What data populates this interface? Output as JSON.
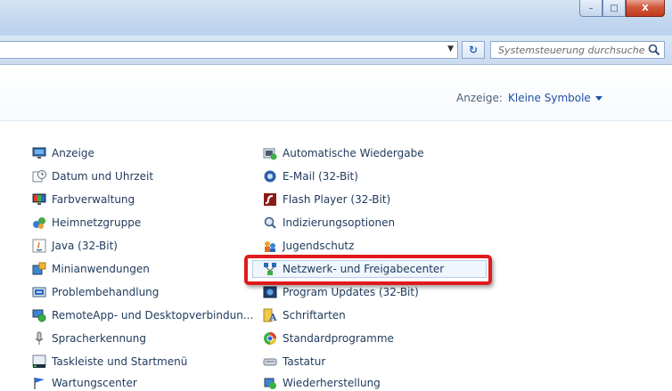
{
  "window": {
    "minimize_label": "–",
    "maximize_label": "□",
    "close_label": "X"
  },
  "toolbar": {
    "refresh_label": "↻",
    "search": {
      "placeholder": "Systemsteuerung durchsuchen",
      "value": ""
    }
  },
  "view": {
    "label": "Anzeige:",
    "selected": "Kleine Symbole"
  },
  "left_column": [
    {
      "label": "Anzeige",
      "icon": "display-icon"
    },
    {
      "label": "Datum und Uhrzeit",
      "icon": "clock-icon"
    },
    {
      "label": "Farbverwaltung",
      "icon": "color-management-icon"
    },
    {
      "label": "Heimnetzgruppe",
      "icon": "homegroup-icon"
    },
    {
      "label": "Java (32-Bit)",
      "icon": "java-icon"
    },
    {
      "label": "Minianwendungen",
      "icon": "gadgets-icon"
    },
    {
      "label": "Problembehandlung",
      "icon": "troubleshooting-icon"
    },
    {
      "label": "RemoteApp- und Desktopverbindun...",
      "icon": "remoteapp-icon"
    },
    {
      "label": "Spracherkennung",
      "icon": "microphone-icon"
    },
    {
      "label": "Taskleiste und Startmenü",
      "icon": "taskbar-icon"
    },
    {
      "label": "Wartungscenter",
      "icon": "flag-icon"
    }
  ],
  "right_column": [
    {
      "label": "Automatische Wiedergabe",
      "icon": "autoplay-icon"
    },
    {
      "label": "E-Mail (32-Bit)",
      "icon": "mail-icon"
    },
    {
      "label": "Flash Player (32-Bit)",
      "icon": "flash-icon"
    },
    {
      "label": "Indizierungsoptionen",
      "icon": "indexing-icon"
    },
    {
      "label": "Jugendschutz",
      "icon": "parental-controls-icon"
    },
    {
      "label": "Netzwerk- und Freigabecenter",
      "icon": "network-icon"
    },
    {
      "label": "Program Updates (32-Bit)",
      "icon": "program-updates-icon"
    },
    {
      "label": "Schriftarten",
      "icon": "fonts-icon"
    },
    {
      "label": "Standardprogramme",
      "icon": "default-programs-icon"
    },
    {
      "label": "Tastatur",
      "icon": "keyboard-icon"
    },
    {
      "label": "Wiederherstellung",
      "icon": "recovery-icon"
    }
  ]
}
